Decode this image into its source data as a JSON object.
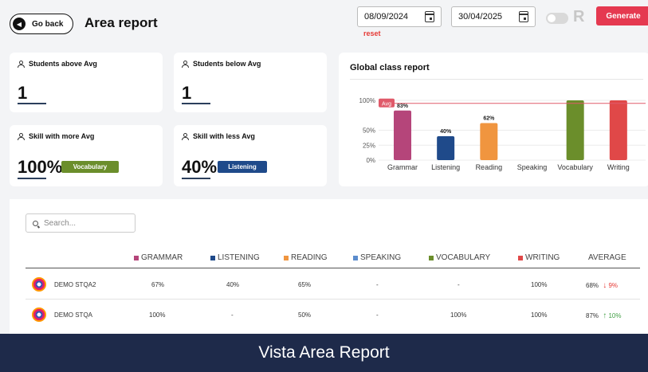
{
  "header": {
    "go_back_label": "Go back",
    "title": "Area report",
    "date_from": "08/09/2024",
    "date_to": "30/04/2025",
    "reset_label": "reset",
    "generate_label": "Generate",
    "logo_letter": "R"
  },
  "stats": {
    "above_avg": {
      "label": "Students above Avg",
      "value": "1"
    },
    "below_avg": {
      "label": "Students below Avg",
      "value": "1"
    },
    "more_avg": {
      "label": "Skill with more Avg",
      "value": "100%",
      "skill": "Vocabulary"
    },
    "less_avg": {
      "label": "Skill with less Avg",
      "value": "40%",
      "skill": "Listening"
    }
  },
  "global_chart": {
    "title": "Global class report",
    "avg_label": "Avg"
  },
  "chart_data": {
    "type": "bar",
    "title": "Global class report",
    "categories": [
      "Grammar",
      "Listening",
      "Reading",
      "Speaking",
      "Vocabulary",
      "Writing"
    ],
    "values": [
      83,
      40,
      62,
      0,
      100,
      100
    ],
    "value_labels": [
      "83%",
      "40%",
      "62%",
      "",
      "",
      ""
    ],
    "colors": [
      "#b5457a",
      "#1f4a8a",
      "#f0953f",
      "#5b8ccd",
      "#6b8e2b",
      "#e04848"
    ],
    "y_ticks": [
      "0%",
      "25%",
      "50%",
      "100%"
    ],
    "ylim": [
      0,
      100
    ],
    "avg_line": 95
  },
  "table": {
    "search_placeholder": "Search...",
    "columns": [
      {
        "label": "GRAMMAR",
        "color": "#b5457a"
      },
      {
        "label": "LISTENING",
        "color": "#1f4a8a"
      },
      {
        "label": "READING",
        "color": "#f0953f"
      },
      {
        "label": "SPEAKING",
        "color": "#5b8ccd"
      },
      {
        "label": "VOCABULARY",
        "color": "#6b8e2b"
      },
      {
        "label": "WRITING",
        "color": "#e04848"
      },
      {
        "label": "AVERAGE",
        "color": ""
      }
    ],
    "rows": [
      {
        "name": "DEMO STQA2",
        "grammar": "67%",
        "listening": "40%",
        "reading": "65%",
        "speaking": "-",
        "vocabulary": "-",
        "writing": "100%",
        "average": "68%",
        "trend": "9%",
        "trend_dir": "down"
      },
      {
        "name": "DEMO STQA",
        "grammar": "100%",
        "listening": "-",
        "reading": "50%",
        "speaking": "-",
        "vocabulary": "100%",
        "writing": "100%",
        "average": "87%",
        "trend": "10%",
        "trend_dir": "up"
      }
    ]
  },
  "caption": "Vista Area Report"
}
